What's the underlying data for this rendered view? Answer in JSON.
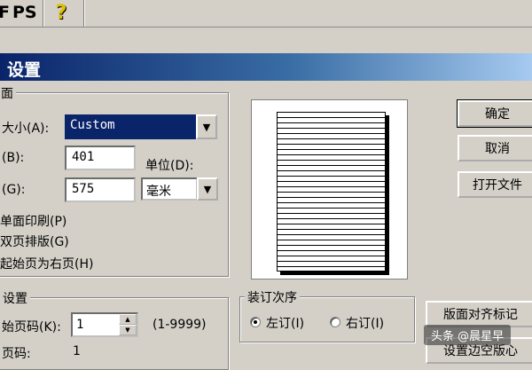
{
  "toolbar": {
    "ps_label": "PS",
    "left_fragment": "F",
    "help_icon": "help-question-icon"
  },
  "dialog": {
    "title": "设置",
    "paper": {
      "group_label": "面",
      "size_label": "大小(A):",
      "size_value": "Custom",
      "width_label": "(B):",
      "width_value": "401",
      "height_label": "(G):",
      "height_value": "575",
      "unit_label": "单位(D):",
      "unit_value": "毫米",
      "single_side": "单面印刷(P)",
      "double_page": "双页排版(G)",
      "start_right": "起始页为右页(H)"
    },
    "page_settings": {
      "group_label": "设置",
      "start_page_label": "始页码(K):",
      "start_page_value": "1",
      "range": "(1-9999)",
      "next_label": "页码:",
      "next_value": "1"
    },
    "binding": {
      "group_label": "装订次序",
      "left": "左订(I)",
      "right": "右订(I)",
      "selected": "left"
    },
    "buttons": {
      "ok": "确定",
      "cancel": "取消",
      "open_file": "打开文件",
      "align_marks": "版面对齐标记",
      "set_margins": "设置边空版心"
    },
    "dropdown_arrow_icon": "chevron-down-icon"
  },
  "watermark": "头条 @晨星早"
}
